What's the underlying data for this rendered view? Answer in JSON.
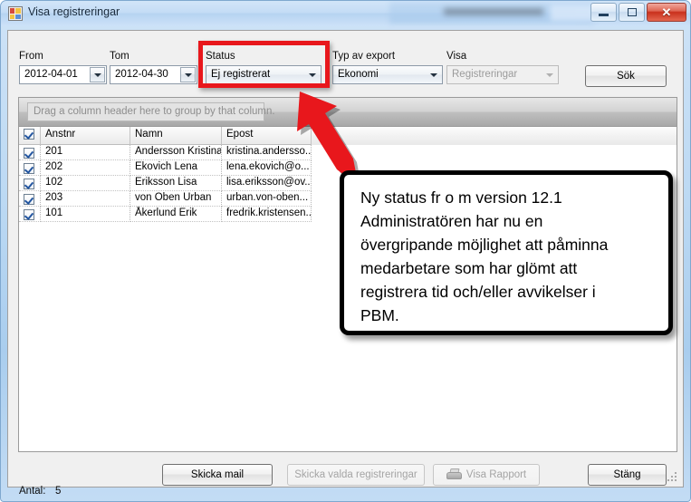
{
  "window": {
    "title": "Visa registreringar",
    "icon": "app-window-icon",
    "controls": {
      "minimize": "minimize-icon",
      "maximize": "maximize-icon",
      "close": "✕"
    }
  },
  "filters": {
    "from": {
      "label": "From",
      "value": "2012-04-01"
    },
    "tom": {
      "label": "Tom",
      "value": "2012-04-30"
    },
    "status": {
      "label": "Status",
      "value": "Ej registrerat",
      "highlighted": true
    },
    "export_type": {
      "label": "Typ av export",
      "value": "Ekonomi"
    },
    "visa": {
      "label": "Visa",
      "value": "Registreringar",
      "enabled": false
    },
    "search_button": "Sök"
  },
  "grid": {
    "group_panel_hint": "Drag a column header here to group by that column.",
    "columns": [
      "Anstnr",
      "Namn",
      "Epost"
    ],
    "select_all_checked": true,
    "rows": [
      {
        "checked": true,
        "anstnr": "201",
        "namn": "Andersson Kristina",
        "epost": "kristina.andersso..."
      },
      {
        "checked": true,
        "anstnr": "202",
        "namn": "Ekovich Lena",
        "epost": "lena.ekovich@o..."
      },
      {
        "checked": true,
        "anstnr": "102",
        "namn": "Eriksson Lisa",
        "epost": "lisa.eriksson@ov..."
      },
      {
        "checked": true,
        "anstnr": "203",
        "namn": "von Oben Urban",
        "epost": "urban.von-oben..."
      },
      {
        "checked": true,
        "anstnr": "101",
        "namn": "Åkerlund Erik",
        "epost": "fredrik.kristensen..."
      }
    ]
  },
  "statusbar": {
    "count_label": "Antal:",
    "count_value": "5"
  },
  "actions": {
    "send_mail": {
      "label": "Skicka mail",
      "enabled": true
    },
    "send_selected": {
      "label": "Skicka valda registreringar",
      "enabled": false
    },
    "show_report": {
      "label": "Visa Rapport",
      "enabled": false,
      "icon": "printer-icon"
    },
    "close": {
      "label": "Stäng",
      "enabled": true
    }
  },
  "annotation": {
    "callout_text": "Ny status fr o m version 12.1\nAdministratören har nu en\növergripande möjlighet att påminna\nmedarbetare som har glömt att\nregistrera tid och/eller avvikelser i\nPBM.",
    "highlight_color": "#e8171c",
    "arrow": "red-arrow-pointing-to-status"
  }
}
